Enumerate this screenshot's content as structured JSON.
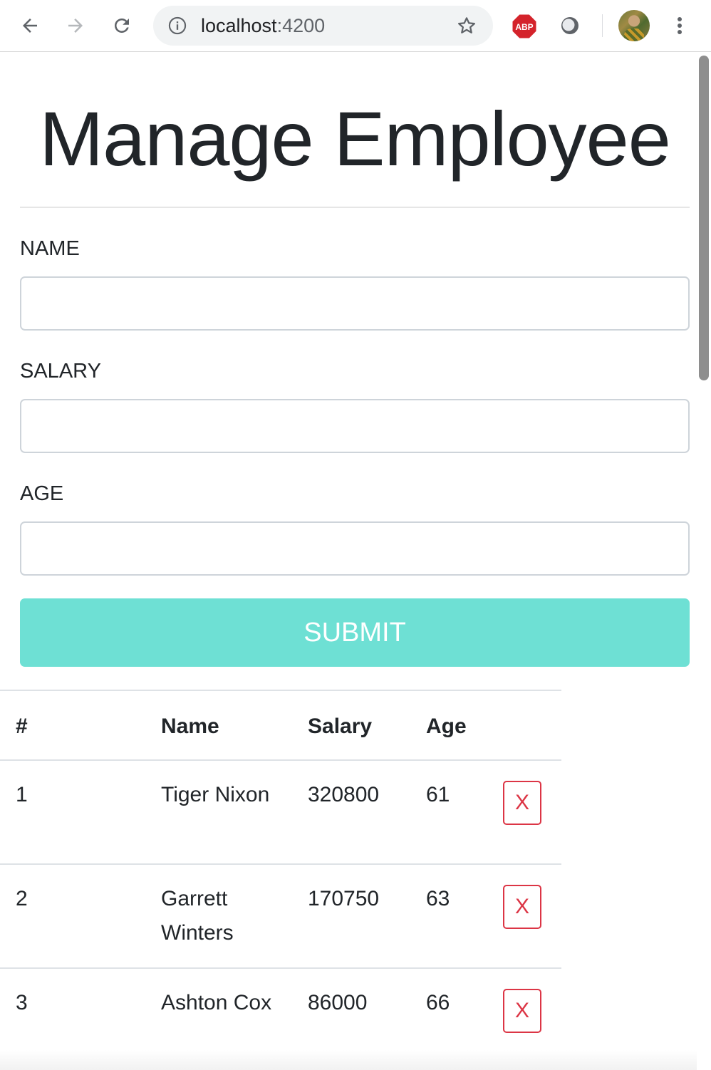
{
  "browser": {
    "url_host": "localhost",
    "url_port": ":4200",
    "extension_badge": "ABP"
  },
  "page": {
    "title": "Manage Employee"
  },
  "form": {
    "name_label": "NAME",
    "name_value": "",
    "salary_label": "SALARY",
    "salary_value": "",
    "age_label": "AGE",
    "age_value": "",
    "submit_label": "SUBMIT"
  },
  "table": {
    "headers": [
      "#",
      "Name",
      "Salary",
      "Age",
      ""
    ],
    "rows": [
      {
        "id": "1",
        "name": "Tiger Nixon",
        "salary": "320800",
        "age": "61",
        "action": "X"
      },
      {
        "id": "2",
        "name": "Garrett Winters",
        "salary": "170750",
        "age": "63",
        "action": "X"
      },
      {
        "id": "3",
        "name": "Ashton Cox",
        "salary": "86000",
        "age": "66",
        "action": "X"
      }
    ]
  },
  "colors": {
    "submit_bg": "#6ee0d4",
    "delete": "#dc3545",
    "text": "#212529"
  }
}
